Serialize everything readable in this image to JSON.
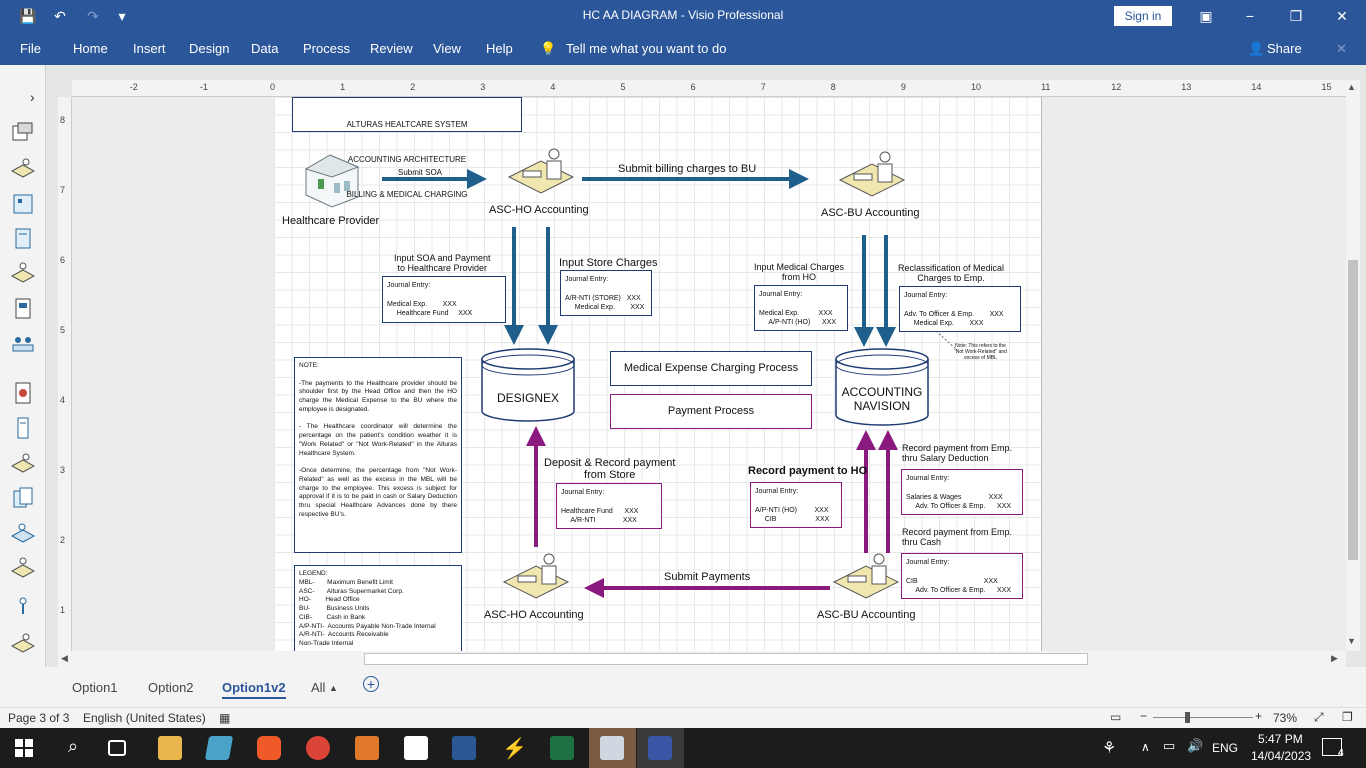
{
  "titlebar": {
    "title": "HC AA DIAGRAM  -  Visio Professional",
    "signin": "Sign in"
  },
  "menu": {
    "items": [
      "File",
      "Home",
      "Insert",
      "Design",
      "Data",
      "Process",
      "Review",
      "View",
      "Help"
    ],
    "tell": "Tell me what you want to do",
    "share": "Share"
  },
  "ruler": {
    "top": [
      "-2",
      "-1",
      "0",
      "1",
      "2",
      "3",
      "4",
      "5",
      "6",
      "7",
      "8",
      "9",
      "10",
      "11",
      "12",
      "13",
      "14",
      "15"
    ],
    "left": [
      "8",
      "7",
      "6",
      "5",
      "4",
      "3",
      "2",
      "1"
    ]
  },
  "diagram": {
    "header_lines": [
      "ALTURAS HEALTCARE SYSTEM",
      "ACCOUNTING ARCHITECTURE",
      "BILLING & MEDICAL CHARGING"
    ],
    "healthcare_provider": "Healthcare Provider",
    "asc_ho_top": "ASC-HO Accounting",
    "asc_bu_top": "ASC-BU Accounting",
    "asc_ho_bottom": "ASC-HO Accounting",
    "asc_bu_bottom": "ASC-BU Accounting",
    "submit_soa": "Submit SOA",
    "submit_billing": "Submit billing charges to BU",
    "submit_payments": "Submit Payments",
    "input_soa_title": "Input SOA and Payment\nto Healthcare Provider",
    "input_soa_entry": "Journal Entry:\n\nMedical Exp.        XXX\n     Healthcare Fund     XXX",
    "input_store_title": "Input Store Charges",
    "input_store_entry": "Journal Entry:\n\nA/R-NTI (STORE)   XXX\n     Medical Exp.        XXX",
    "input_medical_title": "Input Medical Charges\nfrom HO",
    "input_medical_entry": "Journal Entry:\n\nMedical Exp.          XXX\n     A/P-NTI (HO)      XXX",
    "reclass_title": "Reclassification of Medical\nCharges to Emp.",
    "reclass_entry": "Journal Entry:\n\nAdv. To Officer & Emp.        XXX\n     Medical Exp.        XXX",
    "reclass_note": "Note: This refers to the\n\"Not Work-Related\" and\nexcess of MBL",
    "designex": "DESIGNEX",
    "navision": "ACCOUNTING\nNAVISION",
    "legend_med": "Medical Expense Charging Process",
    "legend_pay": "Payment Process",
    "deposit_title": "Deposit & Record payment\nfrom Store",
    "deposit_entry": "Journal Entry:\n\nHealthcare Fund      XXX\n     A/R-NTI              XXX",
    "record_ho_title": "Record payment to HO",
    "record_ho_entry": "Journal Entry:\n\nA/P-NTI (HO)         XXX\n     CIB                    XXX",
    "record_salary_title": "Record payment from Emp.\nthru Salary Deduction",
    "record_salary_entry": "Journal Entry:\n\nSalaries & Wages              XXX\n     Adv. To Officer & Emp.      XXX",
    "record_cash_title": "Record payment from Emp.\nthru Cash",
    "record_cash_entry": "Journal Entry:\n\nCIB                                  XXX\n     Adv. To Officer & Emp.      XXX",
    "note_text": "NOTE:\n\n-The payments to the Healthcare provider should be shoulder first by the Head Office and then the HO charge the Medical Expense to the BU where the employee is designated.\n\n- The Healthcare coordinator will determine the percentage on the patient's condition weather it is \"Work Related\" or \"Not Work-Related\" in the Alturas Healthcare System.\n\n-Once determine, the percentage from \"Not Work-Related\" as well as the excess in the MBL will be charge to the employee. This excess is subject for approval if it is to be paid in cash or Salary Deduction thru special Healthcare Advances done by there respective BU's.",
    "legend_text": "LEGEND:\nMBL-       Maximum Benefit Limit\nASC-       Alturas Supermarket Corp.\nHO-        Head Office\nBU-         Business Units\nCIB-        Cash in Bank\nA/P-NTI-  Accounts Payable Non-Trade Internal\nA/R-NTI-  Accounts Receivable\nNon-Trade Internal"
  },
  "colors": {
    "blue_arrow": "#1f5f8b",
    "purple_arrow": "#8b1a7f",
    "accent": "#2b579a"
  },
  "tabs": [
    "Option1",
    "Option2",
    "Option1v2",
    "All"
  ],
  "status": {
    "page": "Page 3 of 3",
    "language": "English (United States)",
    "zoom": "73%"
  },
  "taskbar": {
    "lang": "ENG",
    "time": "5:47 PM",
    "date": "14/04/2023",
    "notif": "4"
  }
}
